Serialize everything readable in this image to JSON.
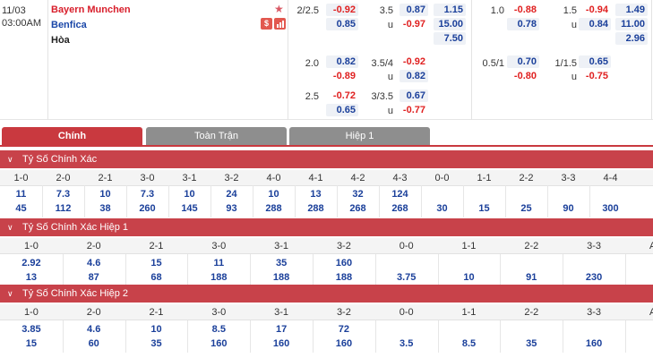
{
  "match": {
    "date": "11/03",
    "time": "03:00AM",
    "home": "Bayern Munchen",
    "away": "Benfica",
    "draw": "Hòa",
    "stats_icon_label": "$"
  },
  "odds": {
    "ft": {
      "hdp": [
        {
          "line": "2/2.5",
          "home": "-0.92",
          "away": "0.85"
        },
        {
          "line": "2.0",
          "home": "0.82",
          "away": "-0.89"
        },
        {
          "line": "2.5",
          "home": "-0.72",
          "away": "0.65"
        }
      ],
      "ou": [
        {
          "line": "3.5",
          "over": "0.87",
          "u": "u",
          "under": "-0.97"
        },
        {
          "line": "3.5/4",
          "over": "-0.92",
          "u": "u",
          "under": "0.82"
        },
        {
          "line": "3/3.5",
          "over": "0.67",
          "u": "u",
          "under": "-0.77"
        }
      ],
      "x12": [
        "1.15",
        "15.00",
        "7.50"
      ]
    },
    "h1": {
      "hdp": [
        {
          "line": "1.0",
          "home": "-0.88",
          "away": "0.78"
        },
        {
          "line": "0.5/1",
          "home": "0.70",
          "away": "-0.80"
        }
      ],
      "ou": [
        {
          "line": "1.5",
          "over": "-0.94",
          "u": "u",
          "under": "0.84"
        },
        {
          "line": "1/1.5",
          "over": "0.65",
          "u": "u",
          "under": "-0.75"
        }
      ],
      "x12": [
        "1.49",
        "11.00",
        "2.96"
      ]
    }
  },
  "tabs": [
    {
      "label": "Chính",
      "active": true
    },
    {
      "label": "Toàn Trận",
      "active": false
    },
    {
      "label": "Hiệp 1",
      "active": false
    }
  ],
  "sections": [
    {
      "title": "Tỷ Số Chính Xác",
      "headers": [
        "1-0",
        "2-0",
        "2-1",
        "3-0",
        "3-1",
        "3-2",
        "4-0",
        "4-1",
        "4-2",
        "4-3",
        "0-0",
        "1-1",
        "2-2",
        "3-3",
        "4-4"
      ],
      "row1": [
        "11",
        "7.3",
        "10",
        "7.3",
        "10",
        "24",
        "10",
        "13",
        "32",
        "124",
        "",
        "",
        "",
        "",
        ""
      ],
      "row2": [
        "45",
        "112",
        "38",
        "260",
        "145",
        "93",
        "288",
        "288",
        "268",
        "268",
        "30",
        "15",
        "25",
        "90",
        "300"
      ]
    },
    {
      "title": "Tỷ Số Chính Xác Hiệp 1",
      "headers": [
        "1-0",
        "2-0",
        "2-1",
        "3-0",
        "3-1",
        "3-2",
        "0-0",
        "1-1",
        "2-2",
        "3-3",
        "AO"
      ],
      "row1": [
        "2.92",
        "4.6",
        "15",
        "11",
        "35",
        "160",
        "",
        "",
        "",
        "",
        ""
      ],
      "row2": [
        "13",
        "87",
        "68",
        "188",
        "188",
        "188",
        "3.75",
        "10",
        "91",
        "230",
        ""
      ]
    },
    {
      "title": "Tỷ Số Chính Xác Hiệp 2",
      "headers": [
        "1-0",
        "2-0",
        "2-1",
        "3-0",
        "3-1",
        "3-2",
        "0-0",
        "1-1",
        "2-2",
        "3-3",
        "AO"
      ],
      "row1": [
        "3.85",
        "4.6",
        "10",
        "8.5",
        "17",
        "72",
        "",
        "",
        "",
        "",
        ""
      ],
      "row2": [
        "15",
        "60",
        "35",
        "160",
        "160",
        "160",
        "3.5",
        "8.5",
        "35",
        "160",
        ""
      ]
    }
  ],
  "colors": {
    "accent": "#c8424a",
    "home": "#d81e2b",
    "away": "#1a47a8",
    "neg": "#e02020",
    "pos": "#1a3f9a"
  }
}
